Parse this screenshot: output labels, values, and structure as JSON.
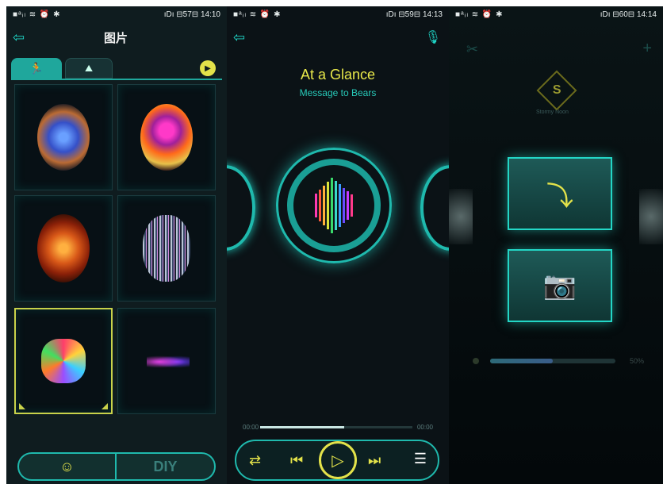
{
  "panel1": {
    "status": {
      "left": "■ᵃᵢₗ ≋ ⏰ ✱",
      "right": "ıDı ⊟57⊟ 14:10"
    },
    "title": "图片",
    "icons": {
      "back": "arrow-back-icon",
      "run": "running-man-icon",
      "image": "landscape-image-icon",
      "play": "play-icon",
      "mask": "theater-mask-icon"
    },
    "diy_label": "DIY"
  },
  "panel2": {
    "status": {
      "left": "■ᵃᵢₗ ≋ ⏰ ✱",
      "right": "ıDı ⊟59⊟ 14:13"
    },
    "song_title": "At a Glance",
    "artist": "Message to Bears",
    "time_start": "00:00",
    "time_end": "00:00",
    "progress": 0.55,
    "icons": {
      "back": "arrow-back-icon",
      "mic": "microphone-icon",
      "repeat": "repeat-icon",
      "prev": "skip-previous-icon",
      "play": "play-icon",
      "next": "skip-next-icon",
      "playlist": "playlist-icon"
    }
  },
  "panel3": {
    "status": {
      "left": "■ᵃᵢₗ ≋ ⏰ ✱",
      "right": "ıDı ⊟60⊟ 14:14"
    },
    "logo_text": "Stormy Noon",
    "progress_label": "50%",
    "progress": 0.5,
    "icons": {
      "tools": "tools-icon",
      "plus": "plus-icon",
      "download": "download-tray-icon",
      "camera": "camera-icon"
    }
  },
  "colors": {
    "accent": "#1fd3c4",
    "yellow": "#e3e24a",
    "title": "#e8e84a",
    "artist": "#27c9b8"
  }
}
